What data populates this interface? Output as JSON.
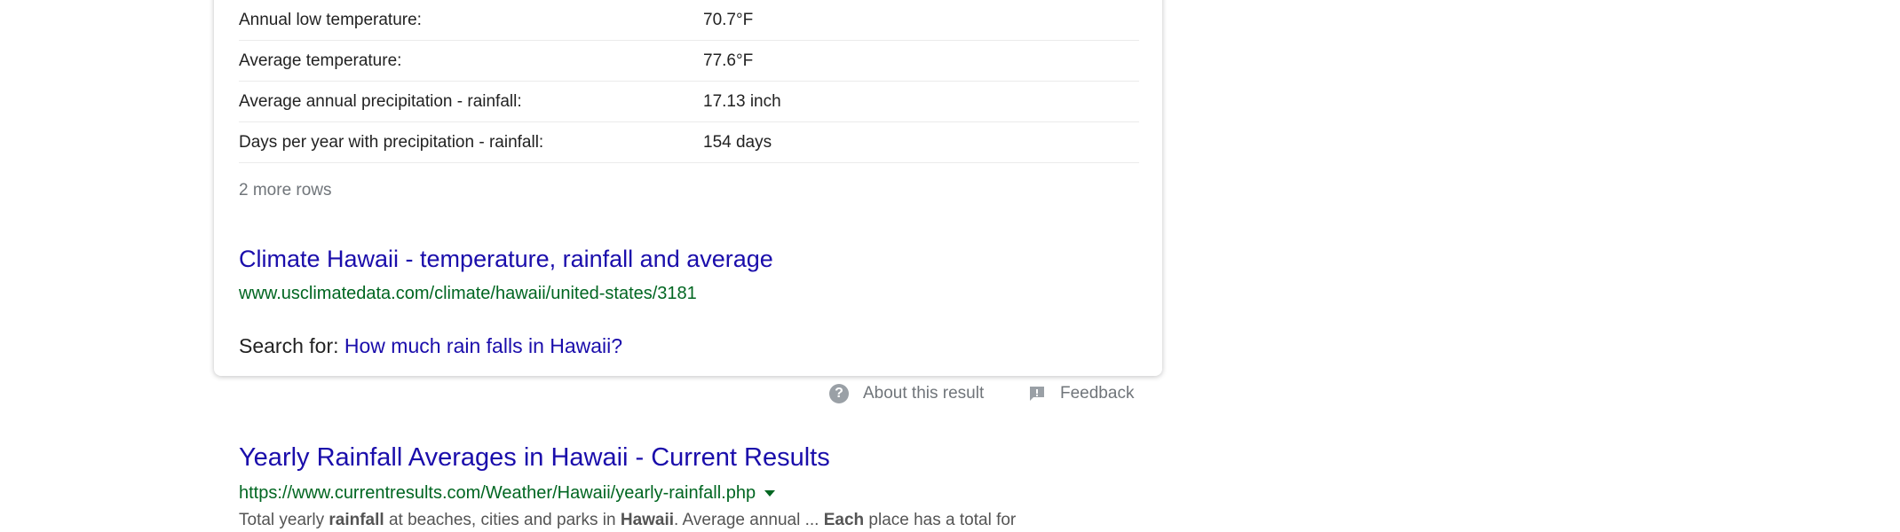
{
  "snippet": {
    "rows": [
      {
        "label": "Annual low temperature:",
        "value": "70.7°F"
      },
      {
        "label": "Average temperature:",
        "value": "77.6°F"
      },
      {
        "label": "Average annual precipitation - rainfall:",
        "value": "17.13 inch"
      },
      {
        "label": "Days per year with precipitation - rainfall:",
        "value": "154 days"
      }
    ],
    "more_rows": "2 more rows",
    "source_title": "Climate Hawaii - temperature, rainfall and average",
    "source_url": "www.usclimatedata.com/climate/hawaii/united-states/3181",
    "search_for_prefix": "Search for:",
    "search_for_link": "How much rain falls in Hawaii?"
  },
  "meta": {
    "about_label": "About this result",
    "feedback_label": "Feedback",
    "about_icon": "question-circle-icon",
    "feedback_icon": "feedback-icon"
  },
  "result2": {
    "title": "Yearly Rainfall Averages in Hawaii - Current Results",
    "url": "https://www.currentresults.com/Weather/Hawaii/yearly-rainfall.php",
    "snippet_parts": [
      {
        "text": "Total yearly ",
        "bold": false
      },
      {
        "text": "rainfall",
        "bold": true
      },
      {
        "text": " at beaches, cities and parks in ",
        "bold": false
      },
      {
        "text": "Hawaii",
        "bold": true
      },
      {
        "text": ". Average annual ... ",
        "bold": false
      },
      {
        "text": "Each",
        "bold": true
      },
      {
        "text": " place has a total for",
        "bold": false
      }
    ]
  },
  "colors": {
    "link": "#1a0dab",
    "url_green": "#006621",
    "muted": "#70757a"
  }
}
